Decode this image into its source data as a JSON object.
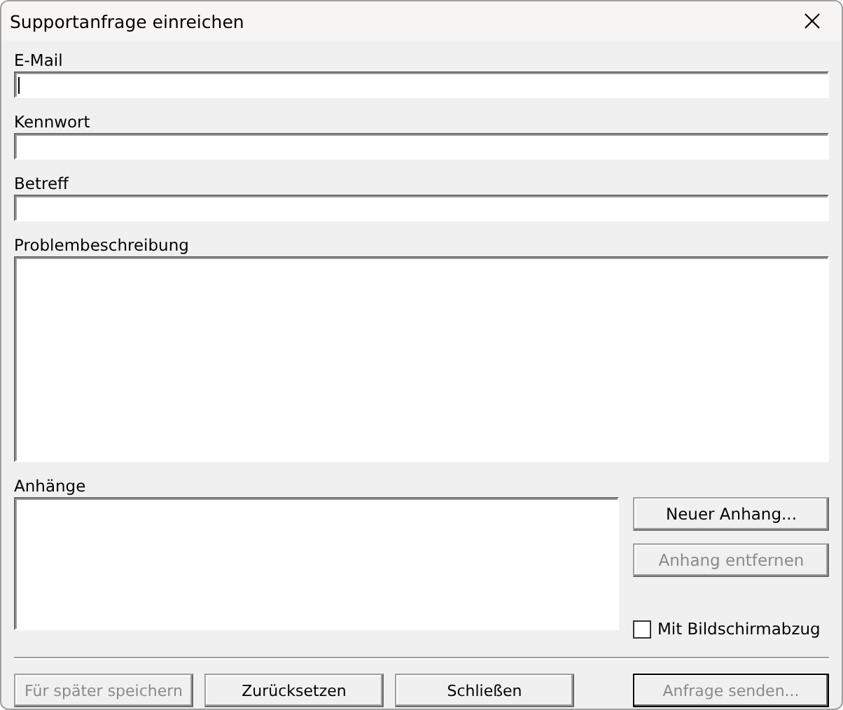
{
  "window": {
    "title": "Supportanfrage einreichen"
  },
  "fields": [
    {
      "label": "E-Mail",
      "kind": "line",
      "focused": true
    },
    {
      "label": "Kennwort",
      "kind": "line",
      "focused": false
    },
    {
      "label": "Betreff",
      "kind": "line",
      "focused": false
    },
    {
      "label": "Problembeschreibung",
      "kind": "area",
      "focused": false
    }
  ],
  "attachments": {
    "label": "Anhänge",
    "buttons": [
      {
        "label": "Neuer Anhang...",
        "disabled": false
      },
      {
        "label": "Anhang entfernen",
        "disabled": true
      }
    ],
    "screenshot_checkbox": {
      "label": "Mit Bildschirmabzug",
      "checked": false
    }
  },
  "footer_buttons": [
    {
      "label": "Für später speichern",
      "disabled": true,
      "default": false
    },
    {
      "label": "Zurücksetzen",
      "disabled": false,
      "default": false
    },
    {
      "label": "Schließen",
      "disabled": false,
      "default": false
    },
    {
      "label": "Anfrage senden...",
      "disabled": true,
      "default": true
    }
  ]
}
